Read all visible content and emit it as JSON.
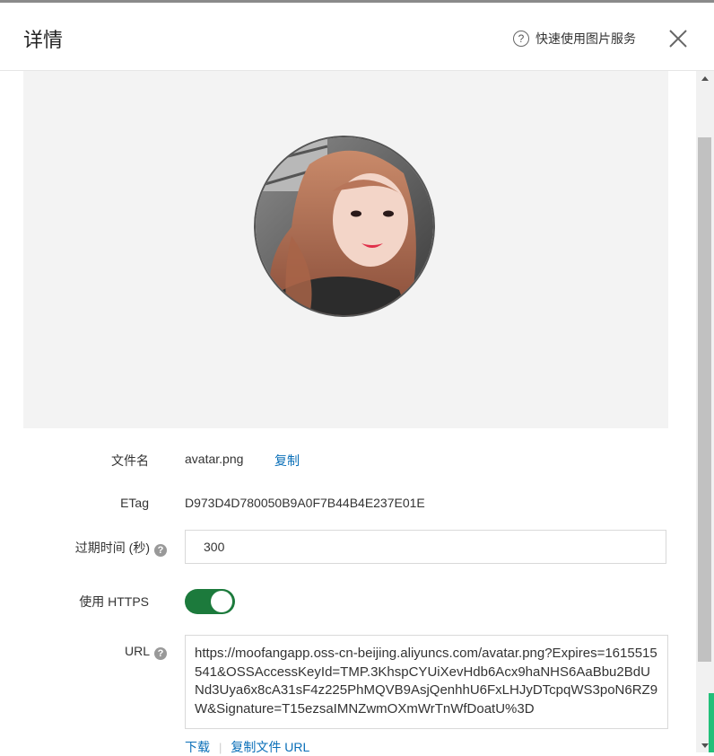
{
  "header": {
    "title": "详情",
    "help_text": "快速使用图片服务",
    "help_icon": "?"
  },
  "preview": {
    "image_alt": "avatar.png"
  },
  "fields": {
    "filename_label": "文件名",
    "filename_value": "avatar.png",
    "copy_label": "复制",
    "etag_label": "ETag",
    "etag_value": "D973D4D780050B9A0F7B44B4E237E01E",
    "expire_label": "过期时间 (秒)",
    "expire_value": "300",
    "https_label": "使用 HTTPS",
    "https_enabled": true,
    "url_label": "URL",
    "url_value": "https://moofangapp.oss-cn-beijing.aliyuncs.com/avatar.png?Expires=1615515541&OSSAccessKeyId=TMP.3KhspCYUiXevHdb6Acx9haNHS6AaBbu2BdUNd3Uya6x8cA31sF4z225PhMQVB9AsjQenhhU6FxLHJyDTcpqWS3poN6RZ9W&Signature=T15ezsaIMNZwmOXmWrTnWfDoatU%3D",
    "download_label": "下载",
    "copy_url_label": "复制文件 URL"
  },
  "colors": {
    "accent_link": "#0a6fb8",
    "toggle_on": "#1c7a3c"
  }
}
